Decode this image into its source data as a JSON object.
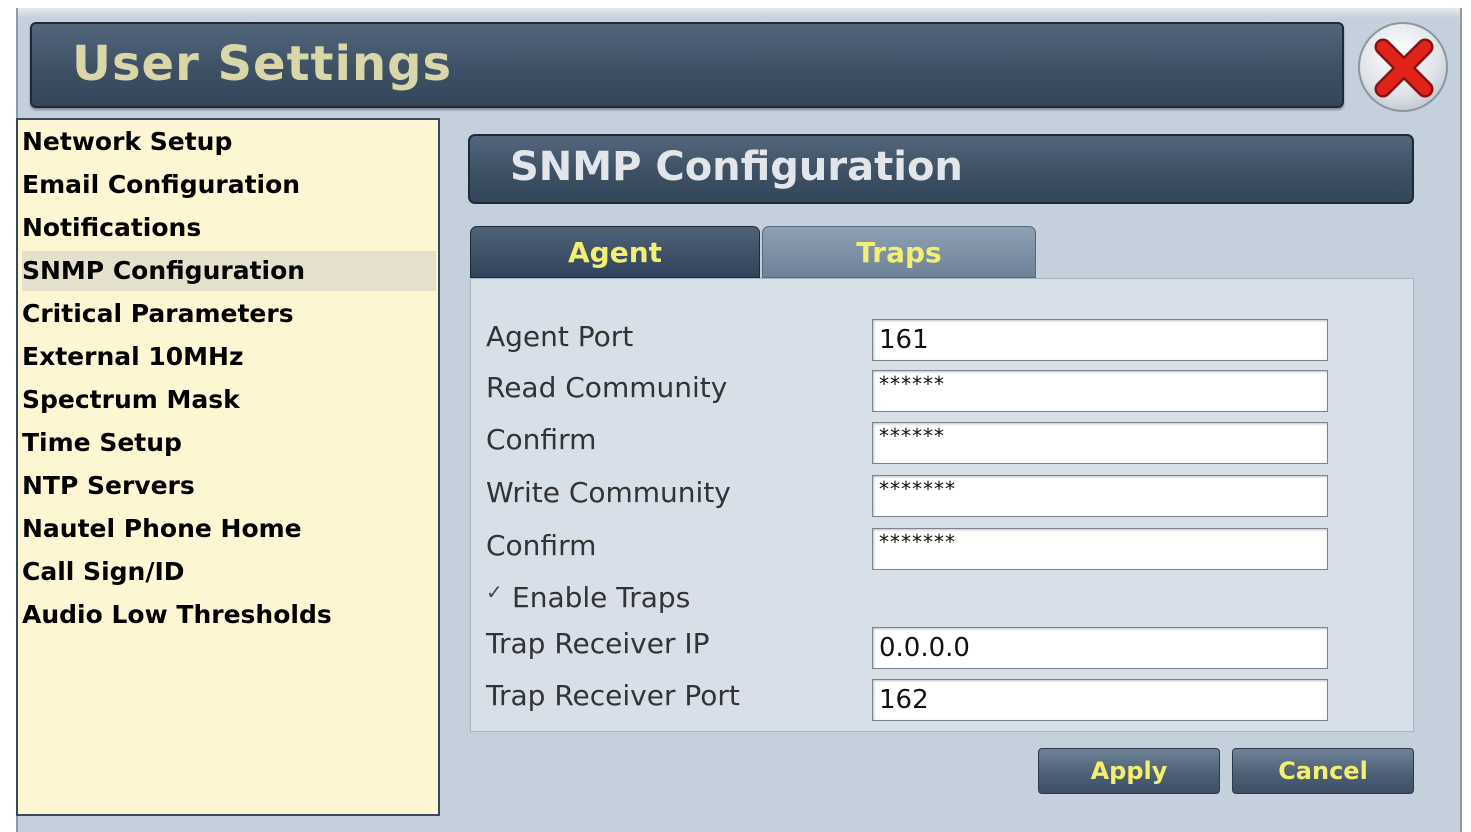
{
  "window": {
    "title": "User Settings",
    "close_icon": "close-icon"
  },
  "sidebar": {
    "items": [
      {
        "label": "Network Setup",
        "selected": false
      },
      {
        "label": "Email Configuration",
        "selected": false
      },
      {
        "label": "Notifications",
        "selected": false
      },
      {
        "label": "SNMP Configuration",
        "selected": true
      },
      {
        "label": "Critical Parameters",
        "selected": false
      },
      {
        "label": "External 10MHz",
        "selected": false
      },
      {
        "label": "Spectrum Mask",
        "selected": false
      },
      {
        "label": "Time Setup",
        "selected": false
      },
      {
        "label": "NTP Servers",
        "selected": false
      },
      {
        "label": "Nautel Phone Home",
        "selected": false
      },
      {
        "label": "Call Sign/ID",
        "selected": false
      },
      {
        "label": "Audio Low Thresholds",
        "selected": false
      }
    ]
  },
  "panel": {
    "title": "SNMP Configuration",
    "tabs": [
      {
        "label": "Agent",
        "active": true
      },
      {
        "label": "Traps",
        "active": false
      }
    ]
  },
  "form": {
    "agent_port": {
      "label": "Agent Port",
      "value": "161"
    },
    "read_community": {
      "label": "Read Community",
      "value": "******"
    },
    "read_confirm": {
      "label": "Confirm",
      "value": "******"
    },
    "write_community": {
      "label": "Write Community",
      "value": "*******"
    },
    "write_confirm": {
      "label": "Confirm",
      "value": "*******"
    },
    "enable_traps": {
      "label": "Enable Traps",
      "checked": true
    },
    "trap_receiver_ip": {
      "label": "Trap Receiver IP",
      "value": "0.0.0.0"
    },
    "trap_receiver_port": {
      "label": "Trap Receiver Port",
      "value": "162"
    }
  },
  "buttons": {
    "apply": "Apply",
    "cancel": "Cancel"
  },
  "colors": {
    "title_text": "#d9d7a8",
    "tab_text": "#f3ef70",
    "sidebar_bg": "#fdf6d2",
    "header_bg": "#3e5064",
    "close_red": "#e0231b"
  }
}
